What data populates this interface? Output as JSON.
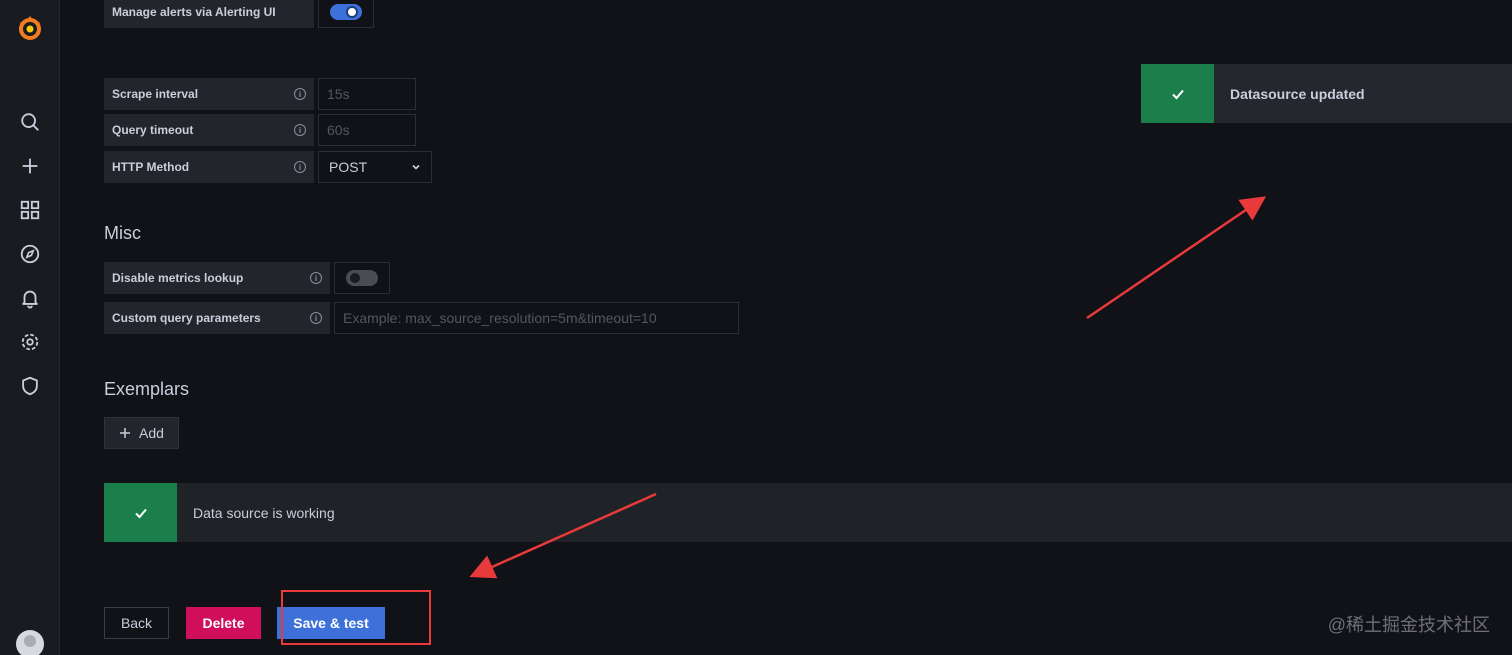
{
  "sidebar": {
    "icons": [
      "grafana-logo-icon",
      "search-icon",
      "plus-icon",
      "dashboards-icon",
      "explore-icon",
      "bell-icon",
      "gear-icon",
      "shield-icon",
      "avatar"
    ]
  },
  "alerting": {
    "manage_label": "Manage alerts via Alerting UI",
    "manage_enabled": true
  },
  "http": {
    "scrape_label": "Scrape interval",
    "scrape_placeholder": "15s",
    "timeout_label": "Query timeout",
    "timeout_placeholder": "60s",
    "method_label": "HTTP Method",
    "method_value": "POST"
  },
  "misc": {
    "title": "Misc",
    "disable_lookup_label": "Disable metrics lookup",
    "disable_lookup_enabled": false,
    "custom_params_label": "Custom query parameters",
    "custom_params_placeholder": "Example: max_source_resolution=5m&timeout=10"
  },
  "exemplars": {
    "title": "Exemplars",
    "add_label": "Add"
  },
  "test_result": {
    "message": "Data source is working"
  },
  "toast": {
    "message": "Datasource updated"
  },
  "actions": {
    "back_label": "Back",
    "delete_label": "Delete",
    "save_label": "Save & test"
  },
  "watermark": "@稀土掘金技术社区",
  "colors": {
    "success": "#1a7f4b",
    "primary": "#3d71d9",
    "destructive": "#d10e5c",
    "annotation": "#e83a3a"
  }
}
